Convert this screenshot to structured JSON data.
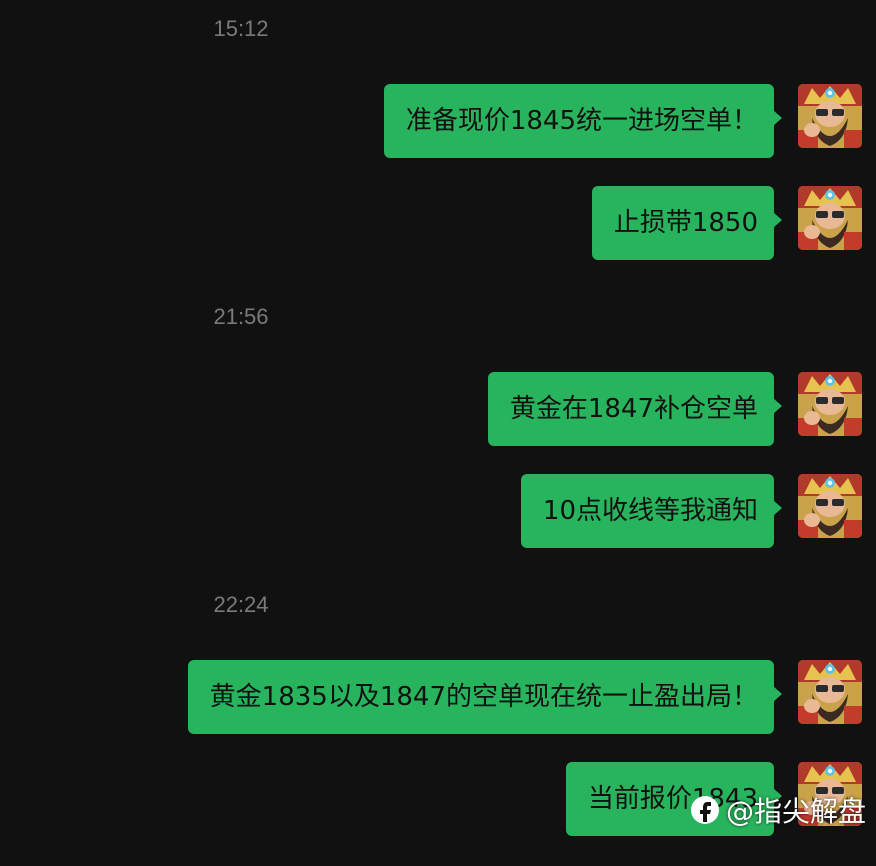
{
  "colors": {
    "background": "#111111",
    "bubble": "#28b45c",
    "timestamp": "#7a7a7a"
  },
  "timestamps": [
    "15:12",
    "21:56",
    "22:24"
  ],
  "messages": [
    {
      "text": "准备现价1845统一进场空单！",
      "sender": "self"
    },
    {
      "text": "止损带1850",
      "sender": "self"
    },
    {
      "text": "黄金在1847补仓空单",
      "sender": "self"
    },
    {
      "text": "10点收线等我通知",
      "sender": "self"
    },
    {
      "text": "黄金1835以及1847的空单现在统一止盈出局！",
      "sender": "self"
    },
    {
      "text": "当前报价1843",
      "sender": "self"
    }
  ],
  "avatar_icon": "bearded-deity-avatar-icon",
  "watermark": {
    "icon": "platform-logo-icon",
    "text": "@指尖解盘"
  }
}
